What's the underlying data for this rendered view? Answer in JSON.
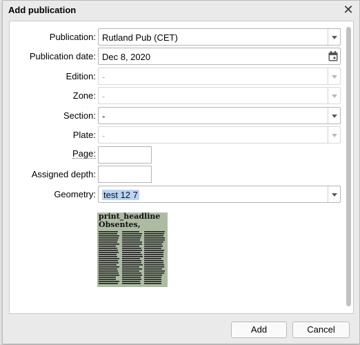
{
  "dialog": {
    "title": "Add publication",
    "close_icon": "close-icon"
  },
  "form": {
    "publication": {
      "label": "Publication:",
      "value": "Rutland Pub (CET)"
    },
    "publication_date": {
      "label": "Publication date:",
      "value": "Dec 8, 2020"
    },
    "edition": {
      "label": "Edition:",
      "value": "-"
    },
    "zone": {
      "label": "Zone:",
      "value": "-"
    },
    "section": {
      "label": "Section:",
      "value": "-"
    },
    "plate": {
      "label": "Plate:",
      "value": "-"
    },
    "page": {
      "label": "Page:",
      "value": ""
    },
    "assigned_depth": {
      "label": "Assigned depth:",
      "value": ""
    },
    "geometry": {
      "label": "Geometry:",
      "value": "test 12 7"
    }
  },
  "preview": {
    "headline": "print_headline",
    "subheadline": "Obsentes,"
  },
  "buttons": {
    "add": "Add",
    "cancel": "Cancel"
  },
  "colors": {
    "selection": "#b9d4f5",
    "preview_bg": "#adbba3"
  }
}
